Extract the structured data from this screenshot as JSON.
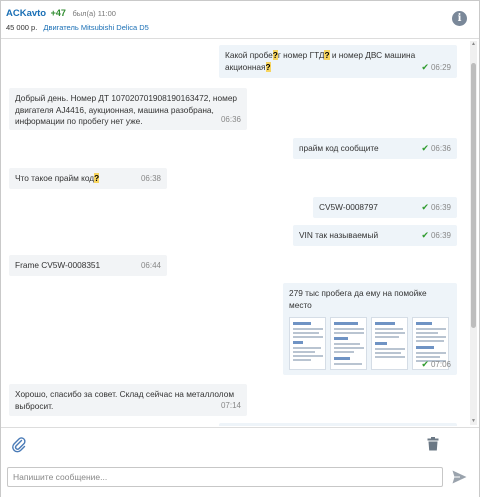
{
  "header": {
    "seller_name": "ACKavto",
    "rating": "+47",
    "status": "был(а) 11:00",
    "price": "45 000 р.",
    "item_title": "Двигатель Mitsubishi Delica D5"
  },
  "messages": [
    {
      "dir": "out",
      "text": "Какой пробе?г номер ГТД? и номер ДВС машина акционная?",
      "time": "06:29",
      "read": true
    },
    {
      "dir": "in",
      "text": "Добрый день. Номер ДТ 10702070190819016347​2, номер двигателя AJ4416, аукционная, машина разобрана, информации по пробегу нет уже.",
      "time": "06:36"
    },
    {
      "dir": "out",
      "text": "прайм код сообщите",
      "time": "06:36",
      "read": true
    },
    {
      "dir": "in",
      "text": "Что такое прайм код?",
      "time": "06:38"
    },
    {
      "dir": "out",
      "text": "CV5W-0008797",
      "time": "06:39",
      "read": true
    },
    {
      "dir": "out",
      "text": "VIN так называемый",
      "time": "06:39",
      "read": true
    },
    {
      "dir": "in",
      "text": "Frame CV5W-0008351",
      "time": "06:44"
    },
    {
      "dir": "out",
      "text": "279 тыс пробега да ему на помойке место",
      "time": "07:06",
      "read": true,
      "attachments": [
        "document-thumbnail",
        "document-thumbnail",
        "document-thumbnail",
        "document-thumbnail"
      ]
    },
    {
      "dir": "in",
      "text": "Хорошо, спасибо за совет. Склад сейчас на металлолом выбросит.",
      "time": "07:14"
    }
  ],
  "composer": {
    "placeholder": "Напишите сообщение..."
  },
  "icons": {
    "info": "info-icon",
    "attach": "paperclip-icon",
    "delete": "trash-icon",
    "send": "send-icon",
    "read": "checkmark-icon"
  },
  "colors": {
    "link": "#1a6fb5",
    "rating": "#2e8b2e",
    "outgoing_bubble": "#eef4f9",
    "incoming_bubble": "#f2f4f6",
    "read_check": "#2e9b2e",
    "highlight": "#f7d560"
  }
}
